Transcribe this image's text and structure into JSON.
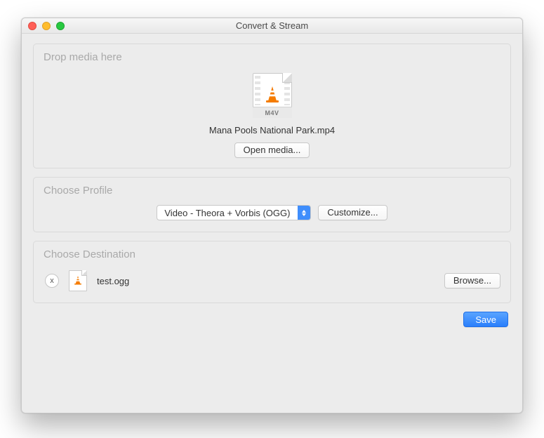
{
  "window": {
    "title": "Convert & Stream"
  },
  "drop": {
    "heading": "Drop media here",
    "file_badge": "M4V",
    "filename": "Mana Pools National Park.mp4",
    "open_button": "Open media..."
  },
  "profile": {
    "heading": "Choose Profile",
    "selected": "Video - Theora + Vorbis (OGG)",
    "customize_button": "Customize..."
  },
  "destination": {
    "heading": "Choose Destination",
    "remove_glyph": "x",
    "filename": "test.ogg",
    "browse_button": "Browse..."
  },
  "footer": {
    "save_button": "Save"
  },
  "icons": {
    "traffic_cone": "cone-icon",
    "file": "file-icon"
  }
}
